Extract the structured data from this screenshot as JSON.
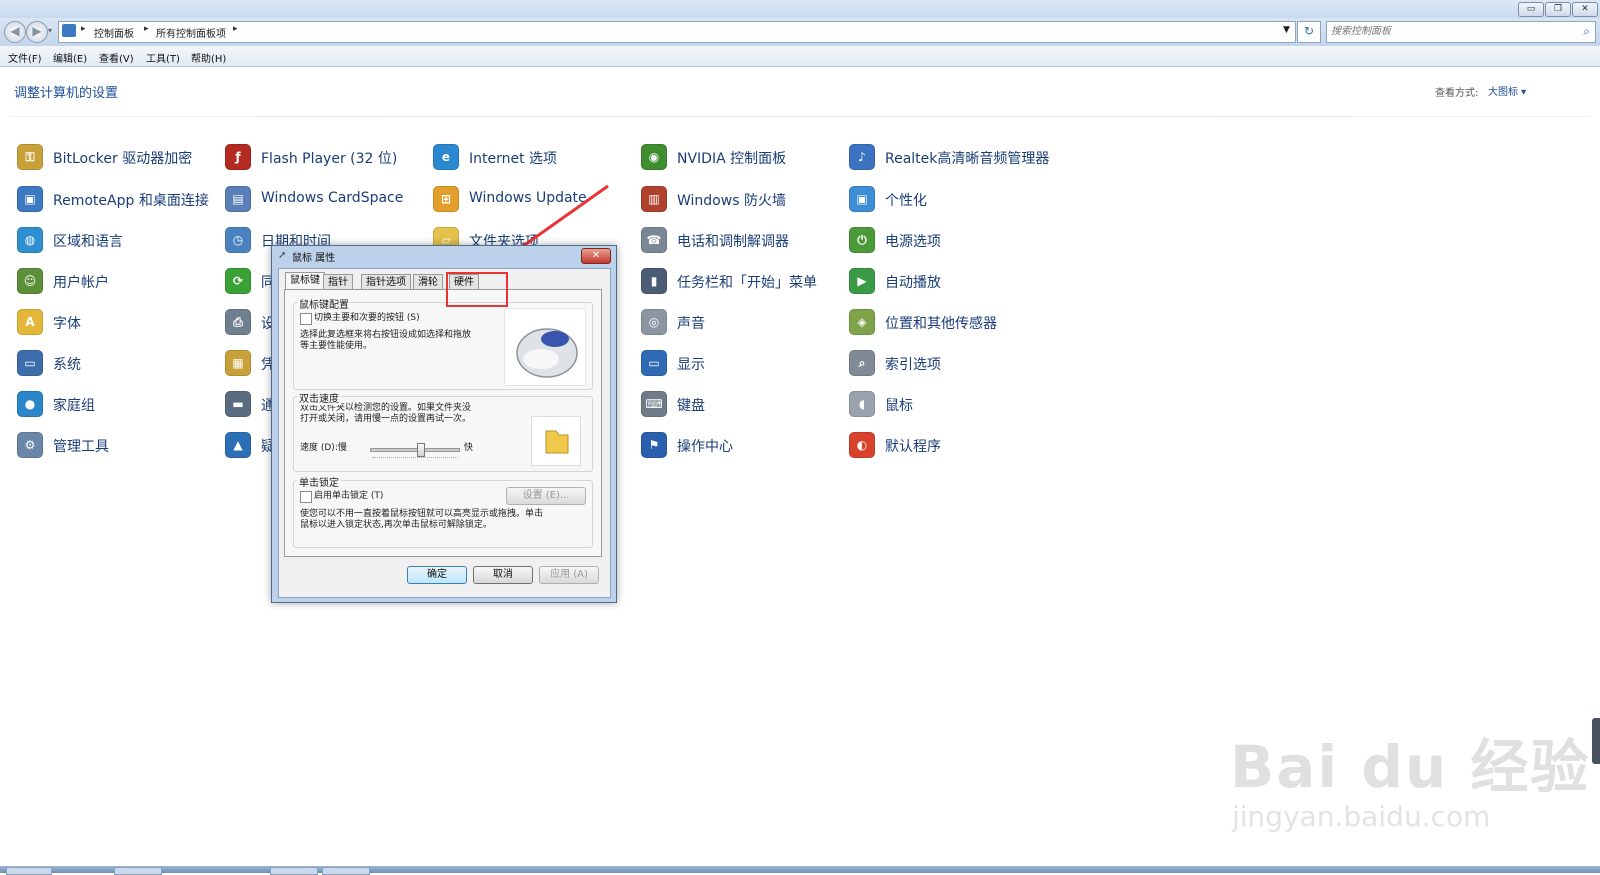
{
  "breadcrumb": [
    "控制面板",
    "所有控制面板项"
  ],
  "search": {
    "placeholder": "搜索控制面板"
  },
  "menu": [
    "文件(F)",
    "编辑(E)",
    "查看(V)",
    "工具(T)",
    "帮助(H)"
  ],
  "page_title": "调整计算机的设置",
  "view": {
    "label": "查看方式:",
    "value": "大图标 ▾"
  },
  "items": [
    {
      "label": "BitLocker 驱动器加密",
      "icon": "key-shield-icon",
      "color": "#c9a13a"
    },
    {
      "label": "RemoteApp 和桌面连接",
      "icon": "remote-desktop-icon",
      "color": "#3b79c3"
    },
    {
      "label": "区域和语言",
      "icon": "globe-icon",
      "color": "#2e8fd1"
    },
    {
      "label": "用户帐户",
      "icon": "users-icon",
      "color": "#5d8f3a"
    },
    {
      "label": "字体",
      "icon": "font-icon",
      "color": "#e4b63a"
    },
    {
      "label": "系统",
      "icon": "computer-icon",
      "color": "#3d6eab"
    },
    {
      "label": "家庭组",
      "icon": "homegroup-icon",
      "color": "#2a86c9"
    },
    {
      "label": "管理工具",
      "icon": "admin-tools-icon",
      "color": "#6a87a8"
    },
    {
      "label": "Flash Player (32 位)",
      "icon": "flash-icon",
      "color": "#b22a20"
    },
    {
      "label": "Windows CardSpace",
      "icon": "cardspace-icon",
      "color": "#5a7fb8"
    },
    {
      "label": "日期和时间",
      "icon": "calendar-icon",
      "color": "#4a82c0"
    },
    {
      "label": "同",
      "icon": "sync-icon",
      "color": "#3aa235"
    },
    {
      "label": "设",
      "icon": "devices-icon",
      "color": "#6f7f90"
    },
    {
      "label": "凭",
      "icon": "credential-icon",
      "color": "#c9a13a"
    },
    {
      "label": "通",
      "icon": "ease-access-icon",
      "color": "#5a6c80"
    },
    {
      "label": "疑",
      "icon": "troubleshoot-icon",
      "color": "#2d6fb5"
    },
    {
      "label": "Internet 选项",
      "icon": "internet-options-icon",
      "color": "#2a88d0"
    },
    {
      "label": "Windows Update",
      "icon": "windows-update-icon",
      "color": "#e2a02b"
    },
    {
      "label": "文件夹选项",
      "icon": "folder-options-icon",
      "color": "#e4c24a"
    },
    {
      "label": "NVIDIA 控制面板",
      "icon": "nvidia-icon",
      "color": "#3f8e2e"
    },
    {
      "label": "Windows 防火墙",
      "icon": "firewall-icon",
      "color": "#b0412c"
    },
    {
      "label": "电话和调制解调器",
      "icon": "phone-modem-icon",
      "color": "#7a8796"
    },
    {
      "label": "任务栏和「开始」菜单",
      "icon": "taskbar-icon",
      "color": "#4a5d75"
    },
    {
      "label": "声音",
      "icon": "sound-icon",
      "color": "#8c96a3"
    },
    {
      "label": "显示",
      "icon": "display-icon",
      "color": "#2f6bb5"
    },
    {
      "label": "键盘",
      "icon": "keyboard-icon",
      "color": "#6f7b88"
    },
    {
      "label": "操作中心",
      "icon": "action-center-flag-icon",
      "color": "#2a5fae"
    },
    {
      "label": "Realtek高清晰音频管理器",
      "icon": "realtek-audio-icon",
      "color": "#3b73c0"
    },
    {
      "label": "个性化",
      "icon": "personalize-icon",
      "color": "#3d8ed5"
    },
    {
      "label": "电源选项",
      "icon": "power-icon",
      "color": "#4a9a3a"
    },
    {
      "label": "自动播放",
      "icon": "autoplay-icon",
      "color": "#3a9a45"
    },
    {
      "label": "位置和其他传感器",
      "icon": "sensor-icon",
      "color": "#7fa34a"
    },
    {
      "label": "索引选项",
      "icon": "indexing-icon",
      "color": "#7f8a96"
    },
    {
      "label": "鼠标",
      "icon": "mouse-icon",
      "color": "#9aa3ad"
    },
    {
      "label": "默认程序",
      "icon": "default-programs-icon",
      "color": "#d9432e"
    }
  ],
  "dialog": {
    "title": "鼠标 属性",
    "tabs": [
      "鼠标键",
      "指针",
      "指针选项",
      "滑轮",
      "硬件"
    ],
    "button_config": {
      "group": "鼠标键配置",
      "checkbox": "切换主要和次要的按钮 (S)",
      "desc_lines": [
        "选择此复选框来将右按钮设成如选择和拖放",
        "等主要性能使用。"
      ]
    },
    "double_click": {
      "group": "双击速度",
      "desc_lines": [
        "双击文件夹以检测您的设置。如果文件夹没",
        "打开或关闭，请用慢一点的设置再试一次。"
      ],
      "speed_label": "速度 (D):慢",
      "fast_label": "快",
      "speed_fraction": 0.57
    },
    "click_lock": {
      "group": "单击锁定",
      "checkbox": "启用单击锁定 (T)",
      "settings_button": "设置 (E)...",
      "desc_lines": [
        "使您可以不用一直按着鼠标按钮就可以高亮显示或拖拽。单击",
        "鼠标以进入锁定状态,再次单击鼠标可解除锁定。"
      ]
    },
    "buttons": {
      "ok": "确定",
      "cancel": "取消",
      "apply": "应用 (A)"
    }
  },
  "watermark": {
    "logo": "Bai du 经验",
    "url": "jingyan.baidu.com"
  }
}
